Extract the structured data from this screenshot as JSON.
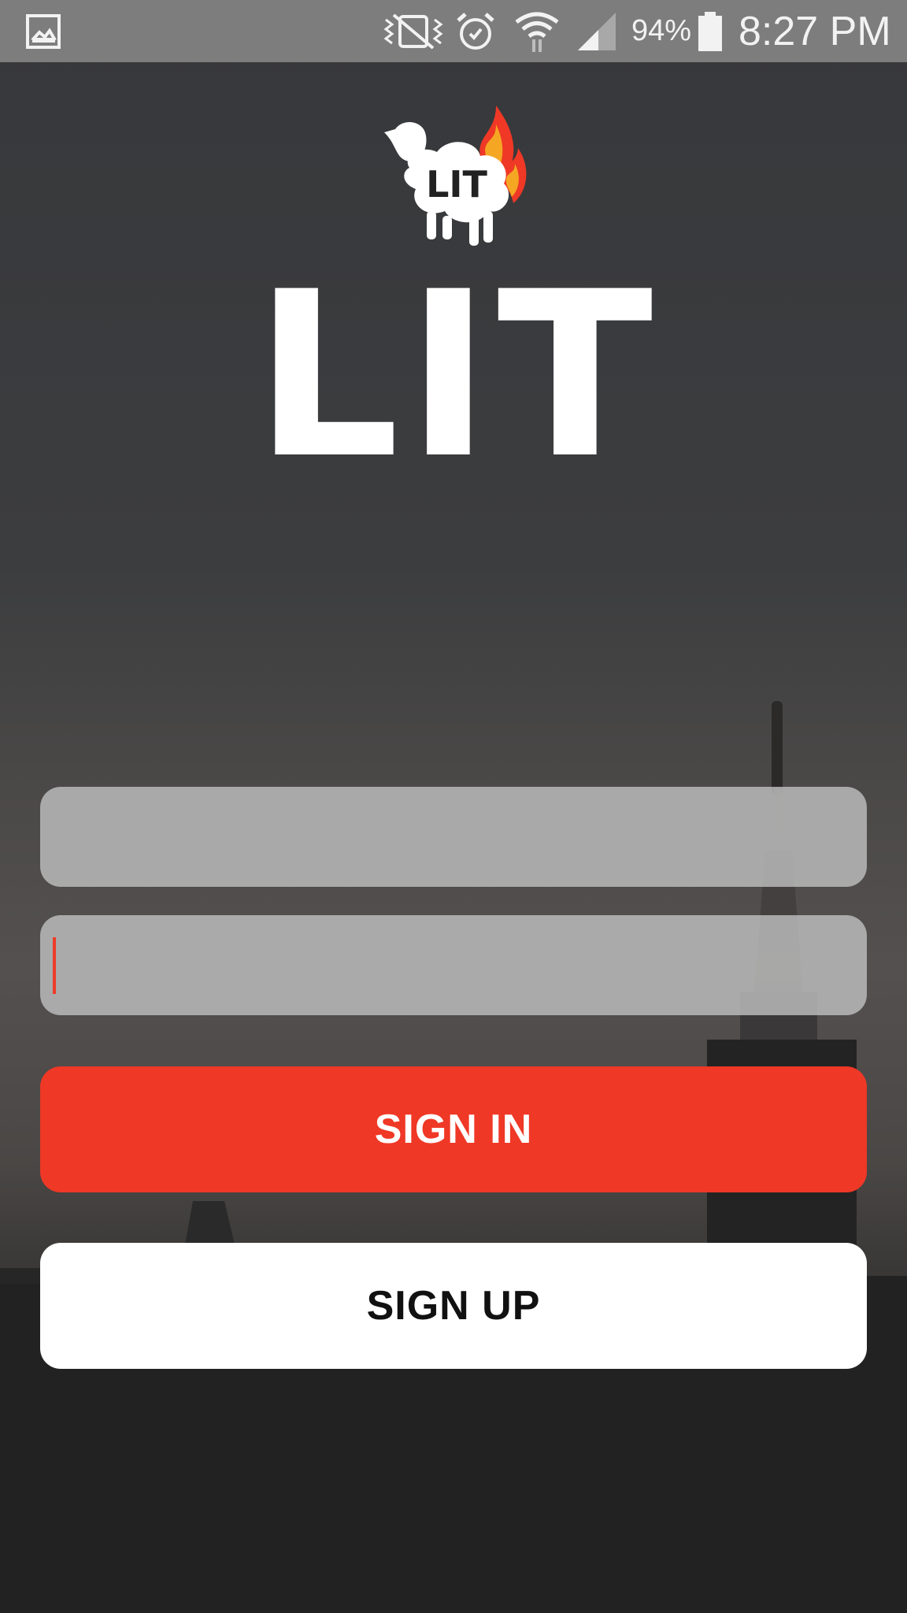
{
  "status_bar": {
    "icons": [
      "gallery-icon",
      "vibrate-icon",
      "alarm-icon",
      "wifi-icon",
      "signal-icon",
      "battery-icon"
    ],
    "battery_percent": "94%",
    "time": "8:27 PM"
  },
  "logo": {
    "badge_text": "LIT",
    "wordmark": "LIT"
  },
  "form": {
    "username_value": "",
    "password_value": "",
    "sign_in_label": "SIGN IN",
    "sign_up_label": "SIGN UP"
  },
  "colors": {
    "accent": "#ef3826",
    "status_bar": "#7d7d7d",
    "field_bg": "#bebebe"
  }
}
